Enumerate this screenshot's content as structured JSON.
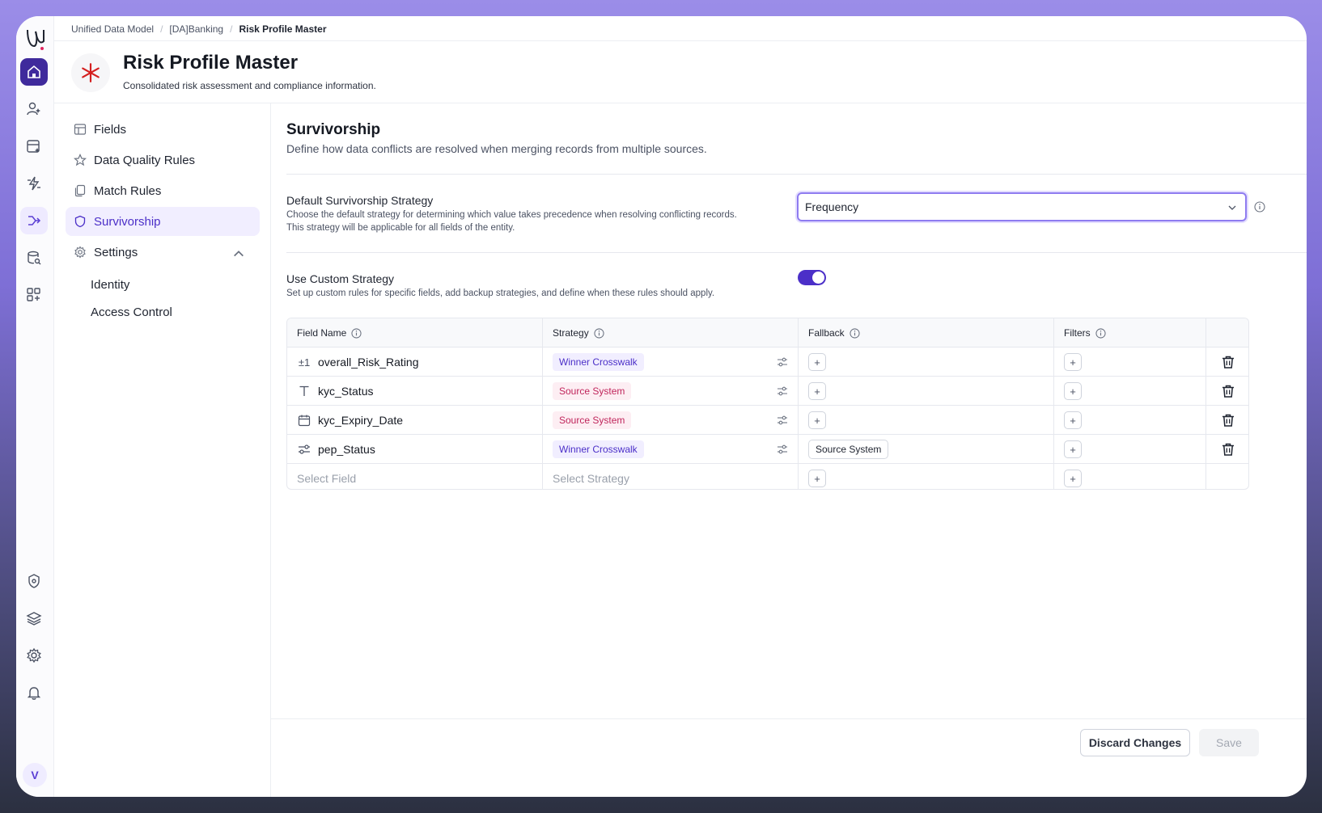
{
  "breadcrumb": {
    "items": [
      "Unified Data Model",
      "[DA]Banking",
      "Risk Profile Master"
    ]
  },
  "header": {
    "title": "Risk Profile Master",
    "subtitle": "Consolidated risk assessment and compliance information."
  },
  "rail": {
    "avatar_letter": "V",
    "icons": [
      "logo-icon",
      "home-icon",
      "user-sparkle-icon",
      "data-sparkle-icon",
      "flash-icon",
      "merge-arrows-icon",
      "database-search-icon",
      "grid-add-icon",
      "shield-settings-icon",
      "layers-icon",
      "gear-icon",
      "bell-icon"
    ]
  },
  "nav": {
    "items": [
      {
        "label": "Fields",
        "icon": "table-icon"
      },
      {
        "label": "Data Quality Rules",
        "icon": "star-icon"
      },
      {
        "label": "Match Rules",
        "icon": "copy-icon"
      },
      {
        "label": "Survivorship",
        "icon": "shield-icon"
      },
      {
        "label": "Settings",
        "icon": "gear-icon"
      }
    ],
    "settings_sub": [
      "Identity",
      "Access Control"
    ]
  },
  "main": {
    "title": "Survivorship",
    "subtitle": "Define how data conflicts are resolved when merging records from multiple sources.",
    "default_strategy": {
      "title": "Default Survivorship Strategy",
      "description": "Choose the default strategy for determining which value takes precedence when resolving conflicting records. This strategy will be applicable for all fields of the entity.",
      "value": "Frequency"
    },
    "custom_strategy": {
      "title": "Use Custom Strategy",
      "description": "Set up custom rules for specific fields, add backup strategies, and define when these rules should apply.",
      "enabled": true
    }
  },
  "table": {
    "headers": [
      "Field Name",
      "Strategy",
      "Fallback",
      "Filters"
    ],
    "rows": [
      {
        "type_glyph": "±1",
        "field": "overall_Risk_Rating",
        "strategy": "Winner Crosswalk",
        "fallback": ""
      },
      {
        "type_glyph": "T",
        "field": "kyc_Status",
        "strategy": "Source System",
        "fallback": ""
      },
      {
        "type_glyph": "cal",
        "field": "kyc_Expiry_Date",
        "strategy": "Source System",
        "fallback": ""
      },
      {
        "type_glyph": "toggle",
        "field": "pep_Status",
        "strategy": "Winner Crosswalk",
        "fallback": "Source System"
      }
    ],
    "new_row": {
      "field_placeholder": "Select Field",
      "strategy_placeholder": "Select Strategy"
    },
    "plus_label": "+"
  },
  "footer": {
    "discard_label": "Discard Changes",
    "save_label": "Save"
  },
  "colors": {
    "accent": "#4b2fc8",
    "badge_purple_text": "#4b2fc8",
    "badge_pink_text": "#c0265c"
  }
}
